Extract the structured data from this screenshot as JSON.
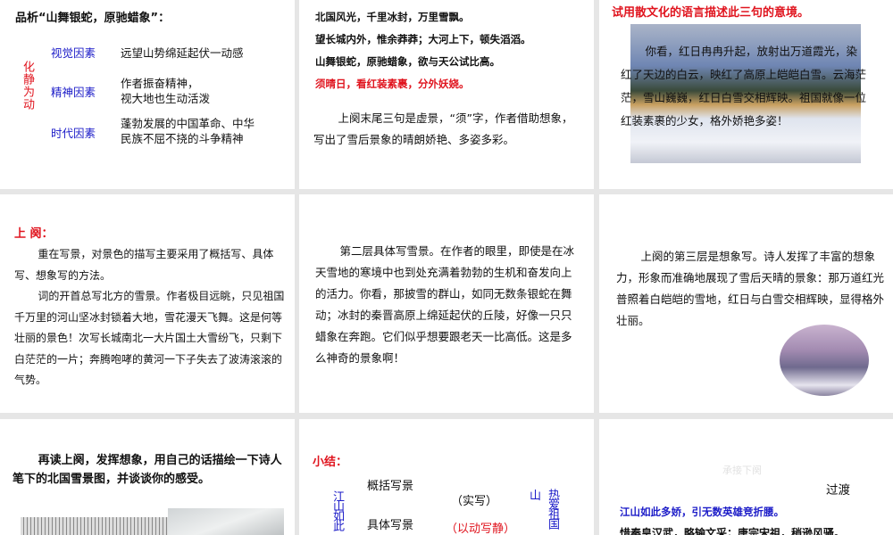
{
  "slide1": {
    "title": "品析“山舞银蛇，原驰蜡象”：",
    "side_label": "化静为动",
    "rows": [
      {
        "label": "视觉因素",
        "text": "远望山势绵延起伏一动感"
      },
      {
        "label": "精神因素",
        "text": "作者振奋精神，\n视大地也生动活泼"
      },
      {
        "label": "时代因素",
        "text": "蓬勃发展的中国革命、中华\n民族不屈不挠的斗争精神"
      }
    ]
  },
  "slide2": {
    "lines": [
      "北国风光，千里冰封，万里雪飘。",
      "望长城内外，惟余莽莽；大河上下，顿失滔滔。",
      "山舞银蛇，原驰蜡象，欲与天公试比高。"
    ],
    "red_line": "须晴日，看红装素裹，分外妖娆。",
    "note": "上阕末尾三句是虚景，“须”字，作者借助想象，写出了雪后景象的晴朗娇艳、多姿多彩。"
  },
  "slide3": {
    "title": "试用散文化的语言描述此三句的意境。",
    "overlay_text": "你看，红日冉冉升起，放射出万道霞光，染红了天边的白云，映红了高原上皑皑白雪。云海茫茫，雪山巍巍，红日白雪交相辉映。祖国就像一位红装素裹的少女，格外娇艳多姿！"
  },
  "slide4": {
    "heading": "上 阕：",
    "paragraphs": [
      "重在写景，对景色的描写主要采用了概括写、具体写、想象写的方法。",
      "词的开首总写北方的雪景。作者极目远眺，只见祖国千万里的河山坚冰封锁着大地，雪花漫天飞舞。这是何等壮丽的景色！次写长城南北一大片国土大雪纷飞，只剩下白茫茫的一片；奔腾咆哮的黄河一下子失去了波涛滚滚的气势。"
    ]
  },
  "slide5": {
    "paragraph": "第二层具体写雪景。在作者的眼里，即使是在冰天雪地的寒境中也到处充满着勃勃的生机和奋发向上的活力。你看，那披雪的群山，如同无数条银蛇在舞动；冰封的秦晋高原上绵延起伏的丘陵，好像一只只蜡象在奔跑。它们似乎想要跟老天一比高低。这是多么神奇的景象啊！"
  },
  "slide6": {
    "paragraph": "上阕的第三层是想象写。诗人发挥了丰富的想象力，形象而准确地展现了雪后天晴的景象：那万道红光普照着白皑皑的雪地，红日与白雪交相辉映，显得格外壮丽。"
  },
  "slide7": {
    "prompt": "再读上阕，发挥想象，用自己的话描绘一下诗人笔下的北国雪景图，并谈谈你的感受。"
  },
  "slide8": {
    "heading": "小结：",
    "left_vertical": "江山如此",
    "item1": "概括写景",
    "item2": "具体写景",
    "note1": "（实写）",
    "note2": "（以动写静）",
    "right_char": "山",
    "right_vertical": "热爱祖国"
  },
  "slide9": {
    "faint_label": "承接下阕",
    "transition": "过渡",
    "blue_line": "江山如此多娇，引无数英雄竞折腰。",
    "black_line": "惜秦皇汉武，略输文采；唐宗宋祖，稍逊风骚。"
  }
}
